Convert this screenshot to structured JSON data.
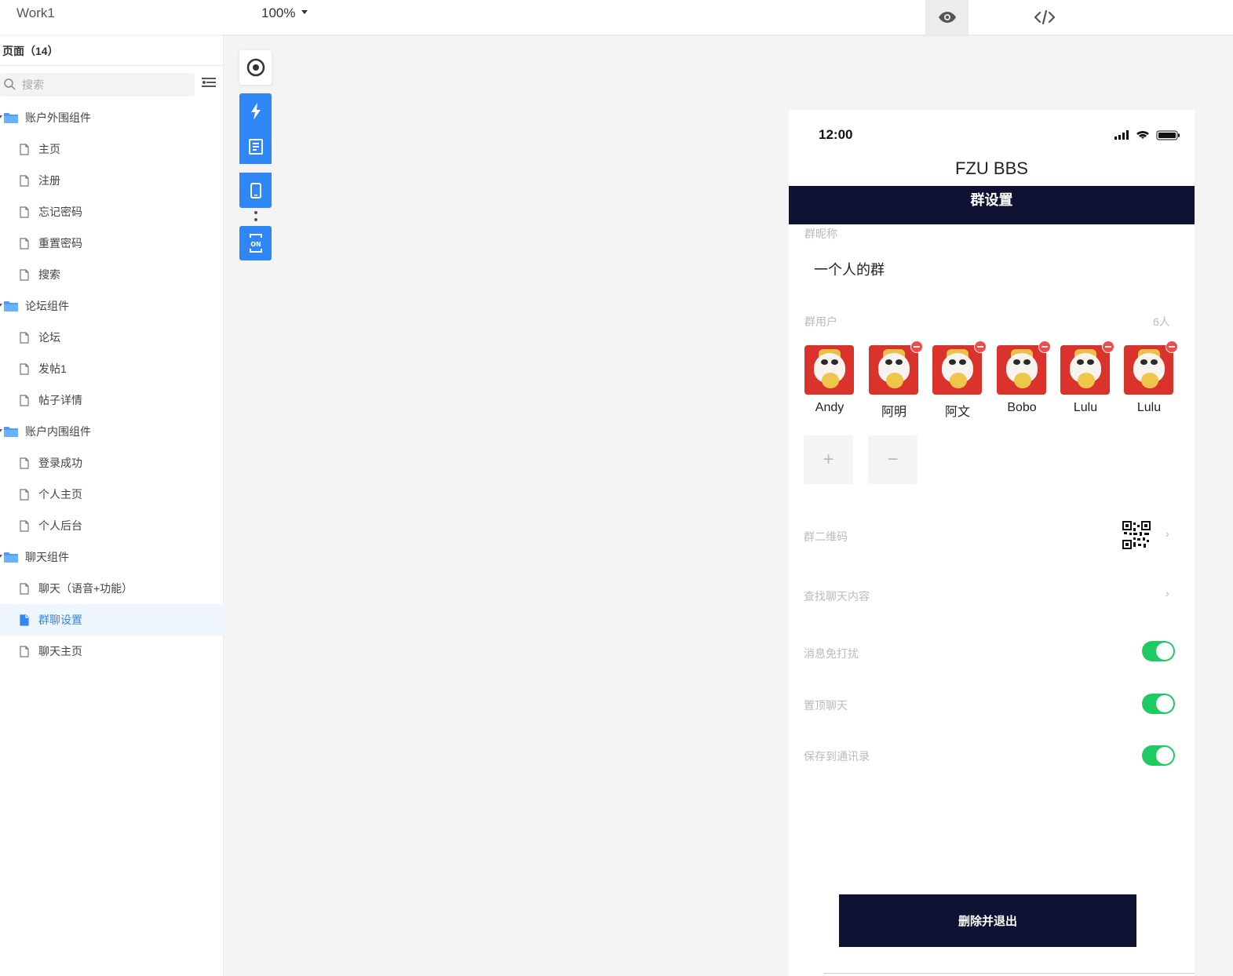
{
  "topbar": {
    "project": "Work1",
    "zoom": "100%"
  },
  "sidebar": {
    "title": "页面（14）",
    "search_placeholder": "搜索",
    "tree": [
      {
        "type": "folder",
        "label": "账户外围组件"
      },
      {
        "type": "page",
        "label": "主页"
      },
      {
        "type": "page",
        "label": "注册"
      },
      {
        "type": "page",
        "label": "忘记密码"
      },
      {
        "type": "page",
        "label": "重置密码"
      },
      {
        "type": "page",
        "label": "搜索"
      },
      {
        "type": "folder",
        "label": "论坛组件"
      },
      {
        "type": "page",
        "label": "论坛"
      },
      {
        "type": "page",
        "label": "发帖1"
      },
      {
        "type": "page",
        "label": "帖子详情"
      },
      {
        "type": "folder",
        "label": "账户内围组件"
      },
      {
        "type": "page",
        "label": "登录成功"
      },
      {
        "type": "page",
        "label": "个人主页"
      },
      {
        "type": "page",
        "label": "个人后台"
      },
      {
        "type": "folder",
        "label": "聊天组件"
      },
      {
        "type": "page",
        "label": "聊天（语音+功能）"
      },
      {
        "type": "page",
        "label": "群聊设置",
        "active": true
      },
      {
        "type": "page",
        "label": "聊天主页"
      }
    ]
  },
  "toolbar_icons": [
    "target-icon",
    "lightning-icon",
    "document-icon",
    "mobile-icon",
    "more-dots-icon",
    "on-toggle-icon"
  ],
  "phone": {
    "time": "12:00",
    "app_title": "FZU BBS",
    "nav_title": "群设置",
    "nickname_label": "群昵称",
    "nickname": "一个人的群",
    "members_label": "群用户",
    "members_count": "6人",
    "members": [
      {
        "name": "Andy",
        "removable": false
      },
      {
        "name": "阿明",
        "removable": true
      },
      {
        "name": "阿文",
        "removable": true
      },
      {
        "name": "Bobo",
        "removable": true
      },
      {
        "name": "Lulu",
        "removable": true
      },
      {
        "name": "Lulu",
        "removable": true
      }
    ],
    "add_symbol": "+",
    "remove_symbol": "−",
    "qr_label": "群二维码",
    "search_label": "查找聊天内容",
    "chevron": "›",
    "settings": [
      {
        "label": "消息免打扰",
        "on": true
      },
      {
        "label": "置顶聊天",
        "on": true
      },
      {
        "label": "保存到通讯录",
        "on": true
      }
    ],
    "quit_button": "删除并退出"
  },
  "colors": {
    "accent": "#2f86f6",
    "navbar": "#0e1233",
    "toggle_on": "#1ecb62",
    "remove": "#f34b4b"
  }
}
